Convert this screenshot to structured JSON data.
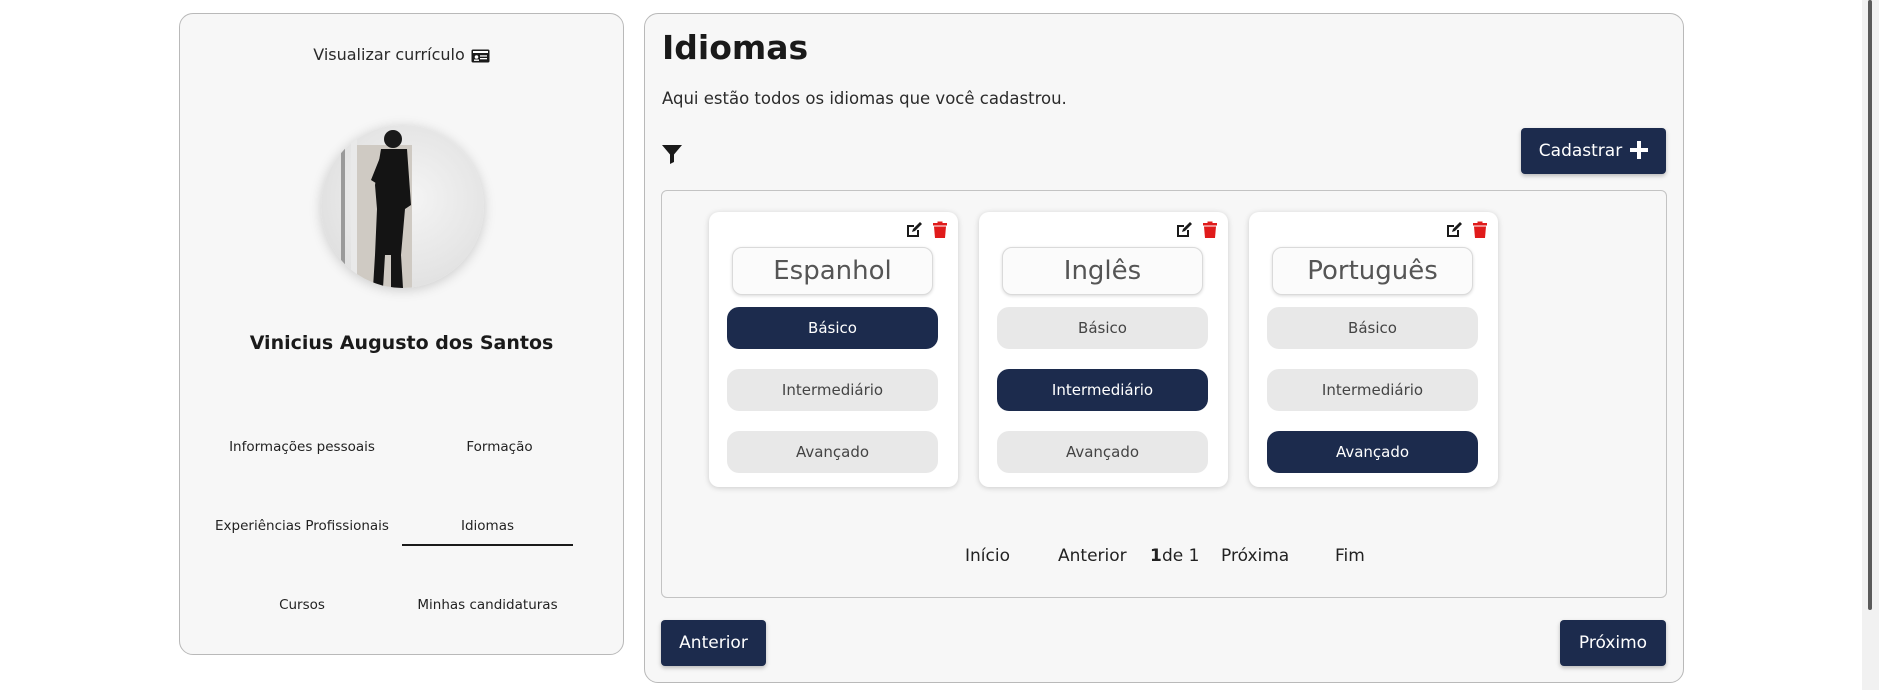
{
  "sidebar": {
    "view_cv_label": "Visualizar currículo",
    "view_cv_icon": "id-card-icon",
    "user_name": "Vinicius Augusto dos Santos",
    "nav": [
      {
        "label": "Informações pessoais",
        "active": false
      },
      {
        "label": "Formação",
        "active": false
      },
      {
        "label": "Experiências Profissionais",
        "active": false
      },
      {
        "label": "Idiomas",
        "active": true
      },
      {
        "label": "Cursos",
        "active": false
      },
      {
        "label": "Minhas candidaturas",
        "active": false
      }
    ]
  },
  "main": {
    "title": "Idiomas",
    "subtitle": "Aqui estão todos os idiomas que você cadastrou.",
    "filter_icon": "filter-icon",
    "register_label": "Cadastrar",
    "register_icon": "plus-icon",
    "cards": [
      {
        "language": "Espanhol",
        "selected_level": "Básico"
      },
      {
        "language": "Inglês",
        "selected_level": "Intermediário"
      },
      {
        "language": "Português",
        "selected_level": "Avançado"
      }
    ],
    "levels": [
      "Básico",
      "Intermediário",
      "Avançado"
    ],
    "card_icons": {
      "edit": "edit-icon",
      "delete": "trash-icon"
    },
    "pagination": {
      "first": "Início",
      "previous": "Anterior",
      "current_page": "1",
      "of_label": "de 1",
      "next": "Próxima",
      "last": "Fim"
    },
    "prev_button": "Anterior",
    "next_button": "Próximo"
  },
  "colors": {
    "primary": "#1c2b4d",
    "level_inactive": "#e8e8e8",
    "delete": "#e01b1b",
    "panel_bg": "#f7f7f7"
  }
}
